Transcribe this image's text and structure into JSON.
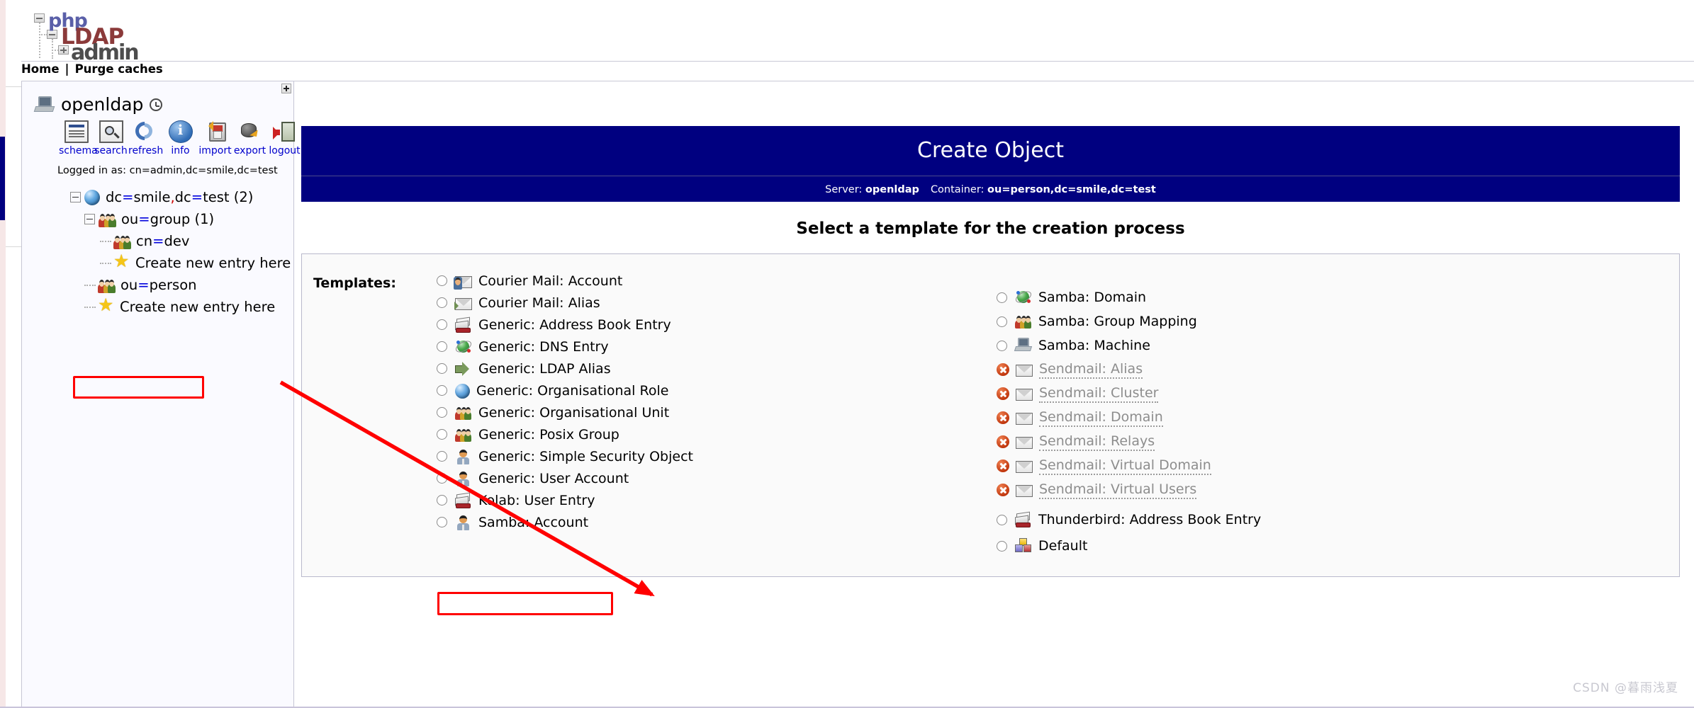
{
  "logo": {
    "part1": "php",
    "part2": "LDAP",
    "part3": "admin"
  },
  "navbar": {
    "home": "Home",
    "separator": "|",
    "purge": "Purge caches"
  },
  "sidebar": {
    "server_name": "openldap",
    "server_icon": "computer-icon",
    "clock_icon": "clock-icon",
    "expand_button": "+",
    "tools": [
      {
        "label": "schema",
        "icon": "schema-document-icon"
      },
      {
        "label": "search",
        "icon": "search-magnifier-icon"
      },
      {
        "label": "refresh",
        "icon": "refresh-arrows-icon"
      },
      {
        "label": "info",
        "icon": "info-circle-icon"
      },
      {
        "label": "import",
        "icon": "import-floppy-icon"
      },
      {
        "label": "export",
        "icon": "export-database-icon"
      },
      {
        "label": "logout",
        "icon": "logout-door-icon"
      }
    ],
    "logged_in_as": "Logged in as: cn=admin,dc=smile,dc=test",
    "tree": [
      {
        "label": "dc=smile,dc=test (2)",
        "icon": "globe-icon",
        "toggle": "minus",
        "indent": 0
      },
      {
        "label": "ou=group (1)",
        "icon": "users-icon",
        "toggle": "minus",
        "indent": 1
      },
      {
        "label": "cn=dev",
        "icon": "users-icon",
        "toggle": "none",
        "indent": 2
      },
      {
        "label": "Create new entry here",
        "icon": "star-icon",
        "toggle": "none",
        "indent": 2
      },
      {
        "label": "ou=person",
        "icon": "users-icon",
        "toggle": "none",
        "indent": 1
      },
      {
        "label": "Create new entry here",
        "icon": "star-icon",
        "toggle": "none",
        "indent": 1
      }
    ]
  },
  "main": {
    "title": "Create Object",
    "server_label": "Server:",
    "server_value": "openldap",
    "container_label": "Container:",
    "container_value": "ou=person,dc=smile,dc=test",
    "select_heading": "Select a template for the creation process",
    "templates_label": "Templates:",
    "templates_left": [
      {
        "label": "Courier Mail: Account",
        "icon": "envelope-person-icon",
        "state": "enabled"
      },
      {
        "label": "Courier Mail: Alias",
        "icon": "envelope-arrow-icon",
        "state": "enabled"
      },
      {
        "label": "Generic: Address Book Entry",
        "icon": "address-book-icon",
        "state": "enabled"
      },
      {
        "label": "Generic: DNS Entry",
        "icon": "dns-globe-icon",
        "state": "enabled"
      },
      {
        "label": "Generic: LDAP Alias",
        "icon": "green-arrow-icon",
        "state": "enabled"
      },
      {
        "label": "Generic: Organisational Role",
        "icon": "globe-icon",
        "state": "enabled"
      },
      {
        "label": "Generic: Organisational Unit",
        "icon": "users-icon",
        "state": "enabled"
      },
      {
        "label": "Generic: Posix Group",
        "icon": "users-icon",
        "state": "enabled"
      },
      {
        "label": "Generic: Simple Security Object",
        "icon": "person-icon",
        "state": "enabled"
      },
      {
        "label": "Generic: User Account",
        "icon": "person-icon",
        "state": "enabled",
        "highlighted": true
      },
      {
        "label": "Kolab: User Entry",
        "icon": "address-book-icon",
        "state": "enabled"
      },
      {
        "label": "Samba: Account",
        "icon": "person-icon",
        "state": "enabled"
      }
    ],
    "templates_right": [
      {
        "label": "Samba: Domain",
        "icon": "dns-globe-icon",
        "state": "enabled"
      },
      {
        "label": "Samba: Group Mapping",
        "icon": "users-icon",
        "state": "enabled"
      },
      {
        "label": "Samba: Machine",
        "icon": "machine-icon",
        "state": "enabled"
      },
      {
        "label": "Sendmail: Alias",
        "icon": "envelope-icon",
        "state": "disabled"
      },
      {
        "label": "Sendmail: Cluster",
        "icon": "envelope-icon",
        "state": "disabled"
      },
      {
        "label": "Sendmail: Domain",
        "icon": "envelope-icon",
        "state": "disabled"
      },
      {
        "label": "Sendmail: Relays",
        "icon": "envelope-icon",
        "state": "disabled"
      },
      {
        "label": "Sendmail: Virtual Domain",
        "icon": "envelope-icon",
        "state": "disabled"
      },
      {
        "label": "Sendmail: Virtual Users",
        "icon": "envelope-icon",
        "state": "disabled"
      },
      {
        "label": "Thunderbird: Address Book Entry",
        "icon": "address-book-icon",
        "state": "enabled"
      },
      {
        "label": "Default",
        "icon": "cubes-icon",
        "state": "enabled"
      }
    ]
  },
  "annotations": {
    "highlight_color": "#ff0000",
    "arrow_color": "#ff0000",
    "boxed_tree_item": "ou=person",
    "boxed_template": "Generic: User Account"
  },
  "watermark": "CSDN @暮雨浅夏",
  "colors": {
    "header_navy": "#000080",
    "link_blue": "#0000cc",
    "panel_bg": "#fafafa",
    "sidebar_bg": "#fafaff"
  }
}
